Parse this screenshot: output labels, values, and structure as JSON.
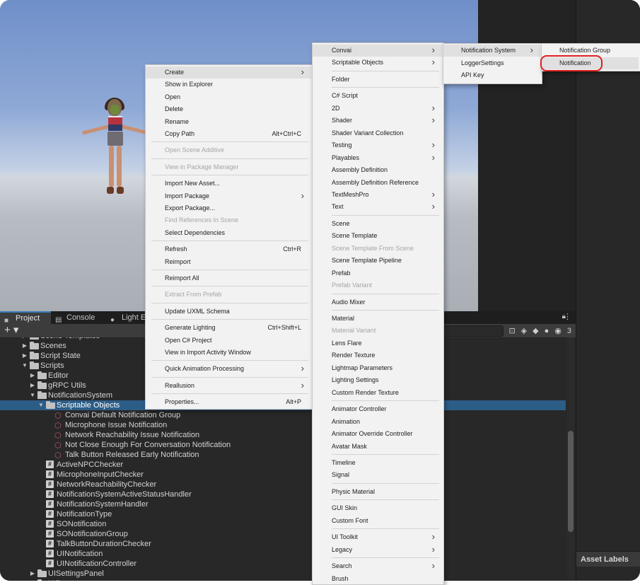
{
  "project_panel": {
    "tabs": [
      {
        "label": "Project",
        "icon": "folder-icon"
      },
      {
        "label": "Console",
        "icon": "console-icon"
      },
      {
        "label": "Light Ex",
        "icon": "lightbulb-icon"
      }
    ],
    "toolbar": {
      "add_label": "+ ▾",
      "hidden_count": "3"
    },
    "tree": [
      {
        "label": "Scene Templates",
        "indent": 0,
        "type": "folder",
        "arrow": "collapsed"
      },
      {
        "label": "Scenes",
        "indent": 0,
        "type": "folder",
        "arrow": "collapsed"
      },
      {
        "label": "Script State",
        "indent": 0,
        "type": "folder",
        "arrow": "collapsed"
      },
      {
        "label": "Scripts",
        "indent": 0,
        "type": "folder",
        "arrow": "expanded"
      },
      {
        "label": "Editor",
        "indent": 1,
        "type": "folder",
        "arrow": "collapsed"
      },
      {
        "label": "gRPC Utils",
        "indent": 1,
        "type": "folder",
        "arrow": "collapsed"
      },
      {
        "label": "NotificationSystem",
        "indent": 1,
        "type": "folder",
        "arrow": "expanded"
      },
      {
        "label": "Scriptable Objects",
        "indent": 2,
        "type": "folder",
        "arrow": "expanded",
        "selected": true
      },
      {
        "label": "Convai Default Notification Group",
        "indent": 3,
        "type": "asset"
      },
      {
        "label": "Microphone Issue Notification",
        "indent": 3,
        "type": "asset"
      },
      {
        "label": "Network Reachability Issue Notification",
        "indent": 3,
        "type": "asset"
      },
      {
        "label": "Not Close Enough For Conversation Notification",
        "indent": 3,
        "type": "asset"
      },
      {
        "label": "Talk Button Released Early Notification",
        "indent": 3,
        "type": "asset"
      },
      {
        "label": "ActiveNPCChecker",
        "indent": 2,
        "type": "script"
      },
      {
        "label": "MicrophoneInputChecker",
        "indent": 2,
        "type": "script"
      },
      {
        "label": "NetworkReachabilityChecker",
        "indent": 2,
        "type": "script"
      },
      {
        "label": "NotificationSystemActiveStatusHandler",
        "indent": 2,
        "type": "script"
      },
      {
        "label": "NotificationSystemHandler",
        "indent": 2,
        "type": "script"
      },
      {
        "label": "NotificationType",
        "indent": 2,
        "type": "script"
      },
      {
        "label": "SONotification",
        "indent": 2,
        "type": "script"
      },
      {
        "label": "SONotificationGroup",
        "indent": 2,
        "type": "script"
      },
      {
        "label": "TalkButtonDurationChecker",
        "indent": 2,
        "type": "script"
      },
      {
        "label": "UINotification",
        "indent": 2,
        "type": "script"
      },
      {
        "label": "UINotificationController",
        "indent": 2,
        "type": "script"
      },
      {
        "label": "UISettingsPanel",
        "indent": 1,
        "type": "folder",
        "arrow": "collapsed"
      },
      {
        "label": "Utils",
        "indent": 1,
        "type": "folder",
        "arrow": "collapsed"
      }
    ]
  },
  "inspector": {
    "asset_labels": "Asset Labels"
  },
  "context_menu": {
    "items": [
      {
        "label": "Create",
        "submenu": true,
        "highlight": true
      },
      {
        "label": "Show in Explorer"
      },
      {
        "label": "Open"
      },
      {
        "label": "Delete"
      },
      {
        "label": "Rename"
      },
      {
        "label": "Copy Path",
        "shortcut": "Alt+Ctrl+C"
      },
      {
        "sep": true
      },
      {
        "label": "Open Scene Additive",
        "disabled": true
      },
      {
        "sep": true
      },
      {
        "label": "View in Package Manager",
        "disabled": true
      },
      {
        "sep": true
      },
      {
        "label": "Import New Asset..."
      },
      {
        "label": "Import Package",
        "submenu": true
      },
      {
        "label": "Export Package..."
      },
      {
        "label": "Find References In Scene",
        "disabled": true
      },
      {
        "label": "Select Dependencies"
      },
      {
        "sep": true
      },
      {
        "label": "Refresh",
        "shortcut": "Ctrl+R"
      },
      {
        "label": "Reimport"
      },
      {
        "sep": true
      },
      {
        "label": "Reimport All"
      },
      {
        "sep": true
      },
      {
        "label": "Extract From Prefab",
        "disabled": true
      },
      {
        "sep": true
      },
      {
        "label": "Update UXML Schema"
      },
      {
        "sep": true
      },
      {
        "label": "Generate Lighting",
        "shortcut": "Ctrl+Shift+L"
      },
      {
        "label": "Open C# Project"
      },
      {
        "label": "View in Import Activity Window"
      },
      {
        "sep": true
      },
      {
        "label": "Quick Animation Processing",
        "submenu": true
      },
      {
        "sep": true
      },
      {
        "label": "Reallusion",
        "submenu": true
      },
      {
        "sep": true
      },
      {
        "label": "Properties...",
        "shortcut": "Alt+P"
      }
    ]
  },
  "create_menu": {
    "items": [
      {
        "label": "Convai",
        "submenu": true,
        "highlight": true
      },
      {
        "label": "Scriptable Objects",
        "submenu": true
      },
      {
        "sep": true
      },
      {
        "label": "Folder"
      },
      {
        "sep": true
      },
      {
        "label": "C# Script"
      },
      {
        "label": "2D",
        "submenu": true
      },
      {
        "label": "Shader",
        "submenu": true
      },
      {
        "label": "Shader Variant Collection"
      },
      {
        "label": "Testing",
        "submenu": true
      },
      {
        "label": "Playables",
        "submenu": true
      },
      {
        "label": "Assembly Definition"
      },
      {
        "label": "Assembly Definition Reference"
      },
      {
        "label": "TextMeshPro",
        "submenu": true
      },
      {
        "label": "Text",
        "submenu": true
      },
      {
        "sep": true
      },
      {
        "label": "Scene"
      },
      {
        "label": "Scene Template"
      },
      {
        "label": "Scene Template From Scene",
        "disabled": true
      },
      {
        "label": "Scene Template Pipeline"
      },
      {
        "label": "Prefab"
      },
      {
        "label": "Prefab Variant",
        "disabled": true
      },
      {
        "sep": true
      },
      {
        "label": "Audio Mixer"
      },
      {
        "sep": true
      },
      {
        "label": "Material"
      },
      {
        "label": "Material Variant",
        "disabled": true
      },
      {
        "label": "Lens Flare"
      },
      {
        "label": "Render Texture"
      },
      {
        "label": "Lightmap Parameters"
      },
      {
        "label": "Lighting Settings"
      },
      {
        "label": "Custom Render Texture"
      },
      {
        "sep": true
      },
      {
        "label": "Animator Controller"
      },
      {
        "label": "Animation"
      },
      {
        "label": "Animator Override Controller"
      },
      {
        "label": "Avatar Mask"
      },
      {
        "sep": true
      },
      {
        "label": "Timeline"
      },
      {
        "label": "Signal"
      },
      {
        "sep": true
      },
      {
        "label": "Physic Material"
      },
      {
        "sep": true
      },
      {
        "label": "GUI Skin"
      },
      {
        "label": "Custom Font"
      },
      {
        "sep": true
      },
      {
        "label": "UI Toolkit",
        "submenu": true
      },
      {
        "label": "Legacy",
        "submenu": true
      },
      {
        "sep": true
      },
      {
        "label": "Search",
        "submenu": true
      },
      {
        "label": "Brush"
      }
    ]
  },
  "convai_menu": {
    "items": [
      {
        "label": "Notification System",
        "submenu": true,
        "highlight": true
      },
      {
        "label": "LoggerSettings"
      },
      {
        "label": "API Key"
      }
    ]
  },
  "notification_menu": {
    "items": [
      {
        "label": "Notification Group"
      },
      {
        "label": "Notification",
        "highlight": true,
        "circled": true
      }
    ]
  },
  "colors": {
    "selection": "#2c5d87",
    "annotation": "#e12020"
  }
}
